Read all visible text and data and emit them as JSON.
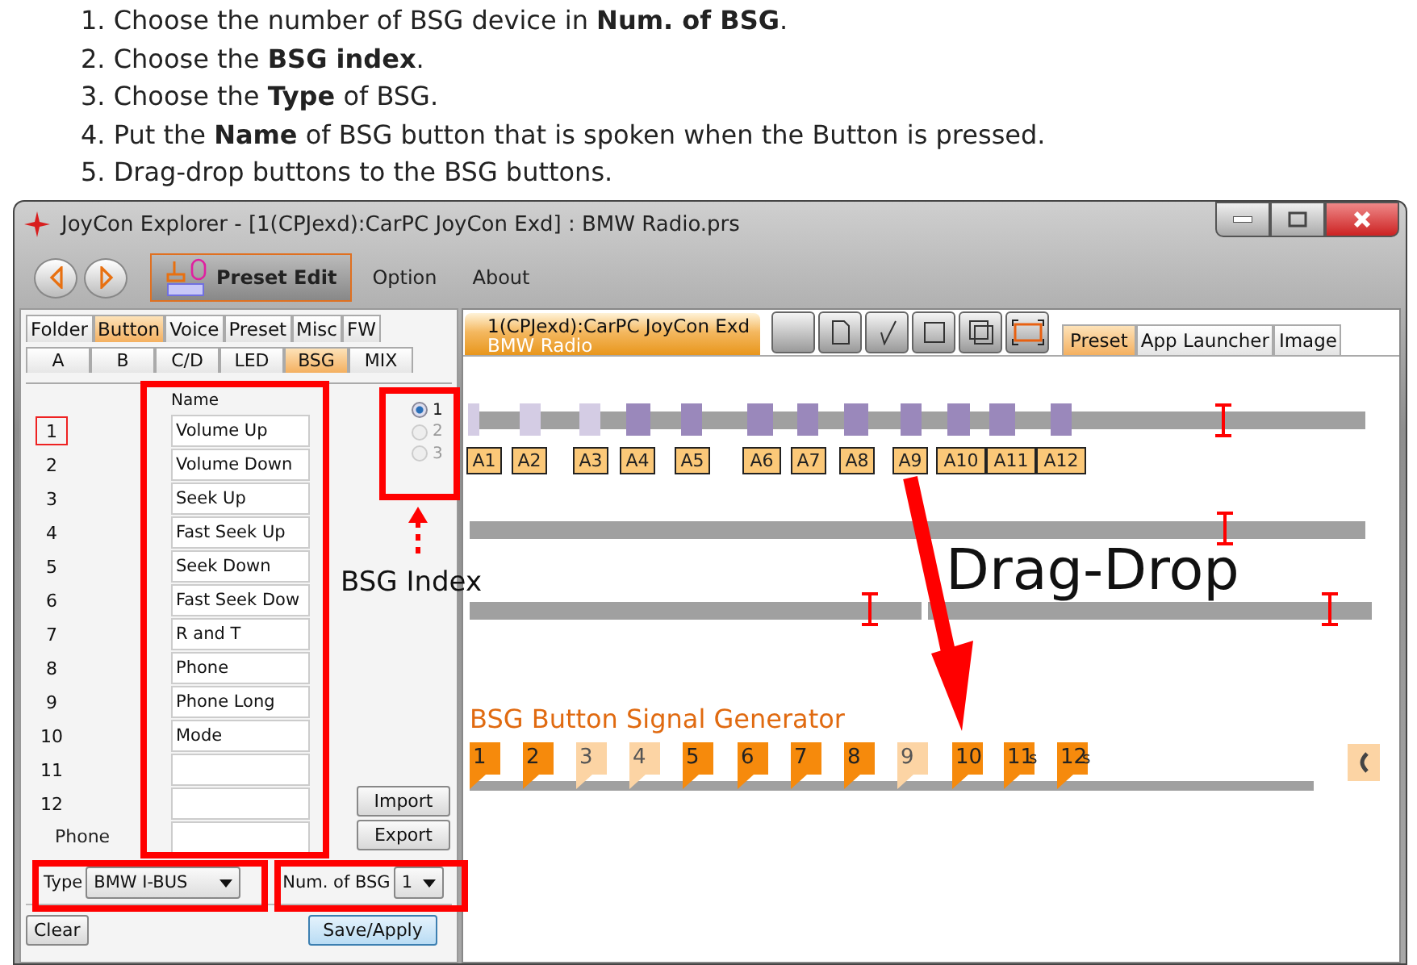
{
  "instructions": [
    "1. Choose the number of BSG device in **Num. of BSG**.",
    "2. Choose the **BSG index**.",
    "3. Choose the **Type** of BSG.",
    "4. Put the **Name** of BSG button that is spoken when the Button is pressed.",
    "5. Drag-drop buttons to the BSG buttons."
  ],
  "window": {
    "title": "JoyCon Explorer - [1(CPJexd):CarPC JoyCon Exd] : BMW Radio.prs"
  },
  "toolbar": [
    {
      "label": "Preset Edit",
      "selected": true
    },
    {
      "label": "Option",
      "selected": false
    },
    {
      "label": "About",
      "selected": false
    }
  ],
  "left_panel": {
    "tabs": [
      {
        "label": "Folder",
        "selected": false
      },
      {
        "label": "Button",
        "selected": true
      },
      {
        "label": "Voice",
        "selected": false
      },
      {
        "label": "Preset",
        "selected": false
      },
      {
        "label": "Misc",
        "selected": false
      },
      {
        "label": "FW",
        "selected": false
      }
    ],
    "subtabs": [
      {
        "label": "A",
        "selected": false
      },
      {
        "label": "B",
        "selected": false
      },
      {
        "label": "C/D",
        "selected": false
      },
      {
        "label": "LED",
        "selected": false
      },
      {
        "label": "BSG",
        "selected": true
      },
      {
        "label": "MIX",
        "selected": false
      }
    ],
    "name_header": "Name",
    "rows": [
      {
        "number": "1",
        "value": "Volume Up",
        "selected": true
      },
      {
        "number": "2",
        "value": "Volume Down",
        "selected": false
      },
      {
        "number": "3",
        "value": "Seek Up",
        "selected": false
      },
      {
        "number": "4",
        "value": "Fast Seek Up",
        "selected": false
      },
      {
        "number": "5",
        "value": "Seek Down",
        "selected": false
      },
      {
        "number": "6",
        "value": "Fast Seek Dow",
        "selected": false
      },
      {
        "number": "7",
        "value": "R and T",
        "selected": false
      },
      {
        "number": "8",
        "value": "Phone",
        "selected": false
      },
      {
        "number": "9",
        "value": "Phone Long",
        "selected": false
      },
      {
        "number": "10",
        "value": "Mode",
        "selected": false
      },
      {
        "number": "11",
        "selected": false
      },
      {
        "number": "12",
        "selected": false
      }
    ],
    "phone_row": {
      "label": "Phone"
    },
    "bsg_index": [
      {
        "label": "1",
        "selected": true,
        "disabled": false
      },
      {
        "label": "2",
        "selected": false,
        "disabled": true
      },
      {
        "label": "3",
        "selected": false,
        "disabled": true
      }
    ],
    "import_button": "Import",
    "export_button": "Export",
    "type": {
      "label": "Type",
      "value": "BMW I-BUS"
    },
    "num_of_bsg": {
      "label": "Num. of BSG",
      "value": "1"
    },
    "clear_button": "Clear",
    "save_button": "Save/Apply"
  },
  "right_panel": {
    "device_tab": {
      "line_1": "1(CPJexd):CarPC JoyCon Exd",
      "line_2": "BMW Radio"
    },
    "tabs": [
      {
        "label": "Preset",
        "selected": true
      },
      {
        "label": "App Launcher",
        "selected": false
      },
      {
        "label": "Image",
        "selected": false
      }
    ],
    "button_track": [
      {
        "label": "A1",
        "dimmed": true
      },
      {
        "label": "A2",
        "dimmed": true
      },
      {
        "label": "A3",
        "dimmed": true
      },
      {
        "label": "A4",
        "dimmed": false
      },
      {
        "label": "A5",
        "dimmed": false
      },
      {
        "label": "A6",
        "dimmed": false
      },
      {
        "label": "A7",
        "dimmed": false
      },
      {
        "label": "A8",
        "dimmed": false
      },
      {
        "label": "A9",
        "dimmed": false
      },
      {
        "label": "A10",
        "dimmed": false
      },
      {
        "label": "A11",
        "dimmed": false
      },
      {
        "label": "A12",
        "dimmed": false
      }
    ],
    "bsg_title": "BSG Button Signal Generator",
    "bsg_buttons": [
      {
        "label": "1",
        "dimmed": false
      },
      {
        "label": "2",
        "dimmed": false
      },
      {
        "label": "3",
        "dimmed": true
      },
      {
        "label": "4",
        "dimmed": true
      },
      {
        "label": "5",
        "dimmed": false
      },
      {
        "label": "6",
        "dimmed": false
      },
      {
        "label": "7",
        "dimmed": false
      },
      {
        "label": "8",
        "dimmed": false
      },
      {
        "label": "9",
        "dimmed": true
      },
      {
        "label": "10",
        "dimmed": false
      },
      {
        "label": "11",
        "suffix": "s",
        "dimmed": false
      },
      {
        "label": "12",
        "suffix": "s",
        "dimmed": false
      }
    ]
  },
  "annotations": {
    "index_label": "BSG Index",
    "drag_label": "Drag-Drop"
  }
}
